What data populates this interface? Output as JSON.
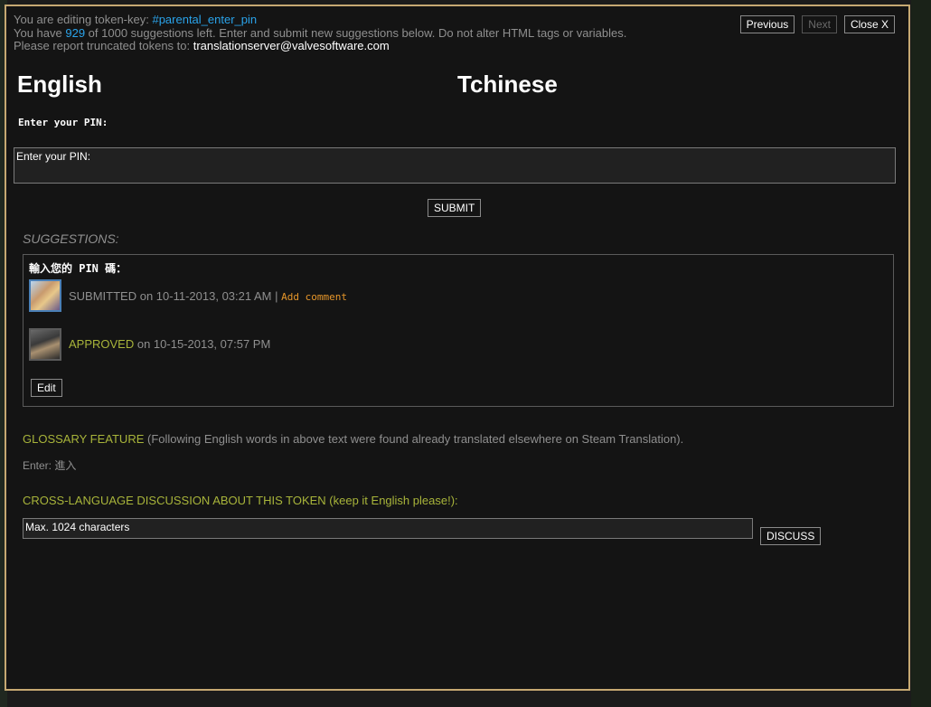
{
  "header": {
    "line1_prefix": "You are editing token-key: ",
    "token_key": "#parental_enter_pin",
    "line2_prefix": "You have ",
    "suggestions_left": "929",
    "line2_suffix": " of 1000 suggestions left. Enter and submit new suggestions below. Do not alter HTML tags or variables.",
    "line3_prefix": "Please report truncated tokens to: ",
    "email": "translationserver@valvesoftware.com"
  },
  "nav": {
    "previous": "Previous",
    "next": "Next",
    "close": "Close X"
  },
  "languages": {
    "source": "English",
    "target": "Tchinese"
  },
  "source_text": "Enter your PIN:",
  "editor": {
    "value": "Enter your PIN:",
    "submit": "SUBMIT"
  },
  "suggestions": {
    "label": "SUGGESTIONS:",
    "text": "輸入您的 PIN 碼：",
    "submitted_label": "SUBMITTED",
    "submitted_date": " on 10-11-2013, 03:21 AM",
    "separator": " | ",
    "add_comment": "Add comment",
    "approved_label": "APPROVED",
    "approved_date": " on 10-15-2013, 07:57 PM",
    "edit": "Edit"
  },
  "glossary": {
    "title": "GLOSSARY FEATURE",
    "description": " (Following English words in above text were found already translated elsewhere on Steam Translation).",
    "entry": "Enter: 進入"
  },
  "discussion": {
    "title": "CROSS-LANGUAGE DISCUSSION ABOUT THIS TOKEN (keep it English please!):",
    "placeholder": "Max. 1024 characters",
    "button": "DISCUSS"
  },
  "colors": {
    "accent_blue": "#2aa3ea",
    "accent_olive": "#a8b43a",
    "accent_orange": "#e6962a",
    "border_gold": "#c6a872"
  }
}
